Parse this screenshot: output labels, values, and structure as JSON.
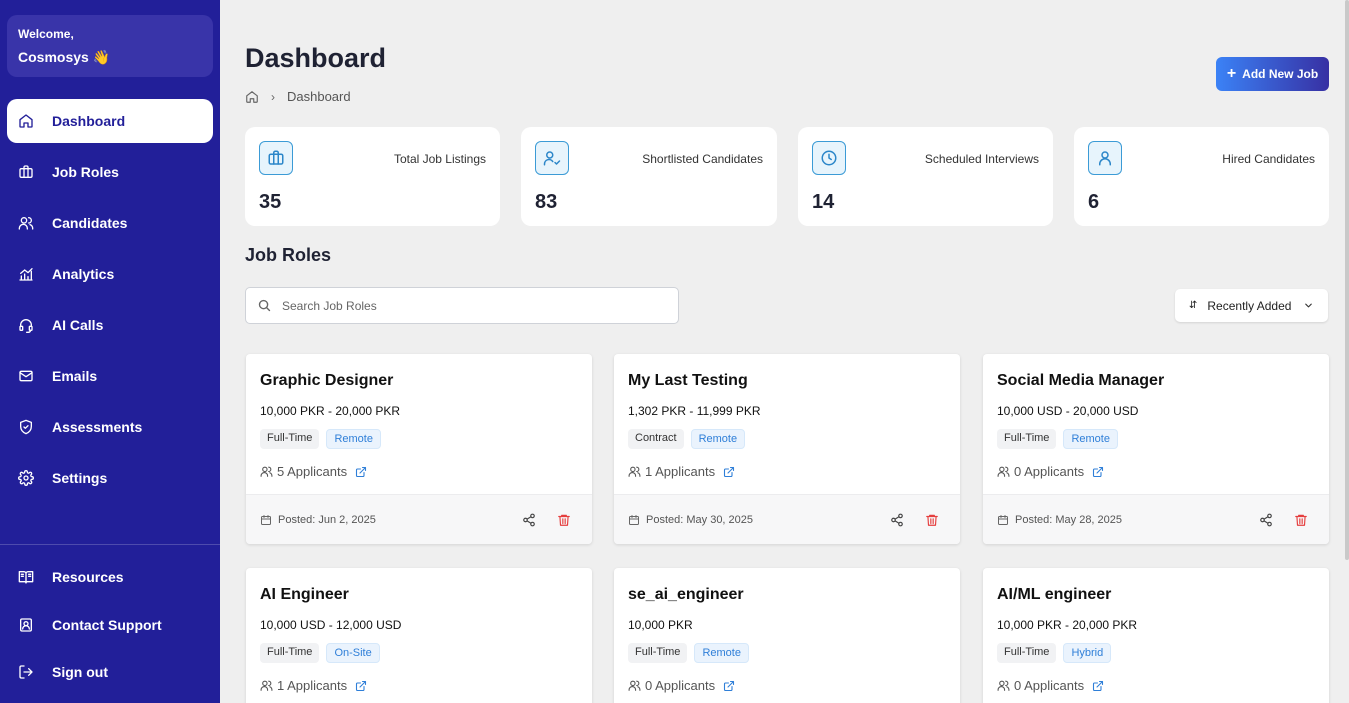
{
  "sidebar": {
    "welcome": "Welcome,",
    "user": "Cosmosys 👋",
    "nav": [
      {
        "label": "Dashboard",
        "icon": "home-icon",
        "active": true
      },
      {
        "label": "Job Roles",
        "icon": "briefcase-icon"
      },
      {
        "label": "Candidates",
        "icon": "users-icon"
      },
      {
        "label": "Analytics",
        "icon": "chart-icon"
      },
      {
        "label": "AI Calls",
        "icon": "headset-icon"
      },
      {
        "label": "Emails",
        "icon": "mail-icon"
      },
      {
        "label": "Assessments",
        "icon": "shield-check-icon"
      },
      {
        "label": "Settings",
        "icon": "gear-icon"
      }
    ],
    "bottom": [
      {
        "label": "Resources",
        "icon": "book-icon"
      },
      {
        "label": "Contact Support",
        "icon": "support-icon"
      },
      {
        "label": "Sign out",
        "icon": "sign-out-icon"
      }
    ]
  },
  "header": {
    "title": "Dashboard",
    "breadcrumb": "Dashboard",
    "add_button": "Add New Job"
  },
  "stats": [
    {
      "label": "Total Job Listings",
      "value": "35",
      "icon": "briefcase-icon"
    },
    {
      "label": "Shortlisted Candidates",
      "value": "83",
      "icon": "user-check-icon"
    },
    {
      "label": "Scheduled Interviews",
      "value": "14",
      "icon": "clock-icon"
    },
    {
      "label": "Hired Candidates",
      "value": "6",
      "icon": "user-icon"
    }
  ],
  "job_roles": {
    "title": "Job Roles",
    "search_placeholder": "Search Job Roles",
    "sort_label": "Recently Added",
    "cards": [
      {
        "title": "Graphic Designer",
        "salary": "10,000 PKR - 20,000 PKR",
        "type": "Full-Time",
        "mode": "Remote",
        "applicants": "5 Applicants",
        "posted": "Posted: Jun 2, 2025"
      },
      {
        "title": "My Last Testing",
        "salary": "1,302 PKR - 11,999 PKR",
        "type": "Contract",
        "mode": "Remote",
        "applicants": "1 Applicants",
        "posted": "Posted: May 30, 2025"
      },
      {
        "title": "Social Media Manager",
        "salary": "10,000 USD - 20,000 USD",
        "type": "Full-Time",
        "mode": "Remote",
        "applicants": "0 Applicants",
        "posted": "Posted: May 28, 2025"
      },
      {
        "title": "AI Engineer",
        "salary": "10,000 USD - 12,000 USD",
        "type": "Full-Time",
        "mode": "On-Site",
        "applicants": "1 Applicants",
        "posted": ""
      },
      {
        "title": "se_ai_engineer",
        "salary": "10,000 PKR",
        "type": "Full-Time",
        "mode": "Remote",
        "applicants": "0 Applicants",
        "posted": ""
      },
      {
        "title": "AI/ML engineer",
        "salary": "10,000 PKR - 20,000 PKR",
        "type": "Full-Time",
        "mode": "Hybrid",
        "applicants": "0 Applicants",
        "posted": ""
      }
    ]
  },
  "colors": {
    "sidebar": "#221f99",
    "accent_blue": "#2f7fd8",
    "delete_red": "#e53e3e"
  }
}
